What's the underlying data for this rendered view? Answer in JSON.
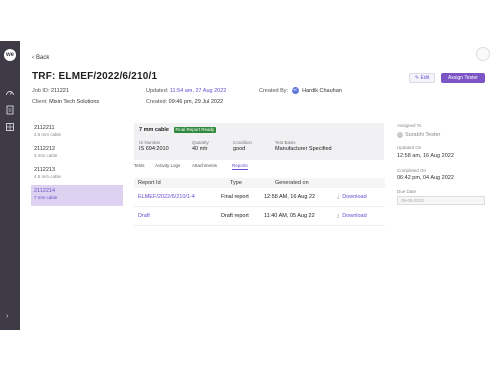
{
  "app": {
    "logo_text": "we",
    "nav_icons": [
      "dashboard-icon",
      "document-icon",
      "grid-icon"
    ],
    "expand_icon": "chevron-right-icon"
  },
  "header": {
    "back_label": "Back",
    "title": "TRF: ELMEF/2022/6/210/1",
    "job_id_label": "Job ID:",
    "job_id": "211221",
    "client_label": "Client:",
    "client": "Mixin Tech Solutions",
    "updated_label": "Updated:",
    "updated": "11:54 am, 27 Aug 2022",
    "created_label": "Created:",
    "created": "09:46 pm, 29 Jul 2022",
    "created_by_label": "Created By:",
    "creator_initials": "HC",
    "creator": "Hardik Chauhan",
    "edit_label": "Edit",
    "assign_label": "Assign Tester"
  },
  "samples": [
    {
      "id": "2112211",
      "desc": "2.5 mm cable",
      "active": false
    },
    {
      "id": "2112212",
      "desc": "3 mm cable",
      "active": false
    },
    {
      "id": "2112213",
      "desc": "4.5 mm cable",
      "active": false
    },
    {
      "id": "2112214",
      "desc": "7 mm cable",
      "active": true
    }
  ],
  "summary": {
    "title": "7 mm cable",
    "badge": "Final Report Ready",
    "fields": [
      {
        "label": "IS Number",
        "value": "IS 694:2010"
      },
      {
        "label": "Quantity",
        "value": "40 mtr"
      },
      {
        "label": "Condition",
        "value": "good"
      },
      {
        "label": "Test Basis",
        "value": "Manufacturer Specified"
      }
    ]
  },
  "tabs": [
    "Tests",
    "Activity Logs",
    "Attachments",
    "Reports"
  ],
  "active_tab": "Reports",
  "reports_table": {
    "columns": [
      "Report Id",
      "Type",
      "Generated on",
      ""
    ],
    "rows": [
      {
        "id": "ELMEF/2022/6/210/1-4",
        "type": "Final report",
        "generated": "12:58 AM, 16 Aug 22",
        "action": "Download"
      },
      {
        "id": "Draft",
        "type": "Draft report",
        "generated": "11:40 AM, 05 Aug 22",
        "action": "Download"
      }
    ]
  },
  "right_panel": {
    "assigned_label": "Assigned To",
    "assigned_to": "Surabhi Tester",
    "updated_on_label": "Updated On",
    "updated_on": "12:58 am, 16 Aug 2022",
    "completed_on_label": "Completed On",
    "completed_on": "06:42 pm, 04 Aug 2022",
    "due_date_label": "Due Date",
    "due_date": "05-08-2022"
  },
  "colors": {
    "accent": "#7b55c6",
    "link": "#6a4bd1",
    "rail": "#3e3b47",
    "badge": "#2f8a3d"
  }
}
